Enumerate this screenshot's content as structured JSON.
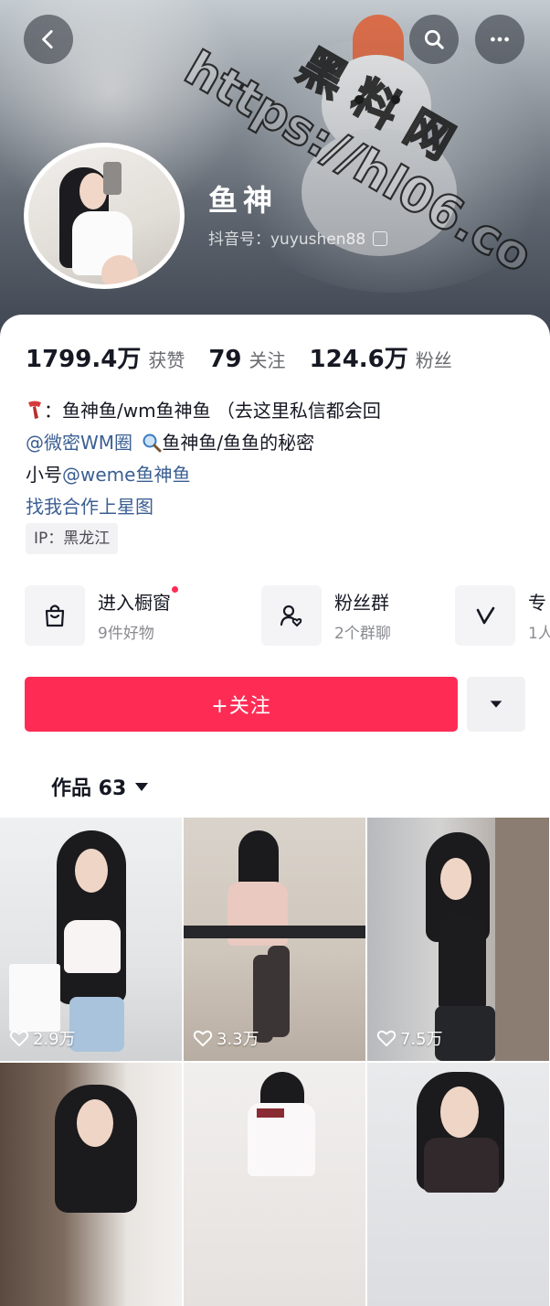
{
  "header": {
    "nickname": "鱼神",
    "douyin_id": "抖音号：yuyushen88",
    "watermark_line1": "黑 料 网",
    "watermark_line2": "https://hl06.co"
  },
  "stats": [
    {
      "value": "1799.4万",
      "label": "获赞"
    },
    {
      "value": "79",
      "label": "关注"
    },
    {
      "value": "124.6万",
      "label": "粉丝"
    }
  ],
  "bio": {
    "line1": "：鱼神鱼/wm鱼神鱼 （去这里私信都会回",
    "line2_link": "@微密WM圈",
    "line2_text": "鱼神鱼/鱼鱼的秘密",
    "line3_prefix": "小号",
    "line3_link": "@weme鱼神鱼",
    "line4_link": "找我合作上星图"
  },
  "ip_tag": "IP：黑龙江",
  "features": [
    {
      "title": "进入橱窗",
      "subtitle": "9件好物",
      "icon": "shopping-bag-icon"
    },
    {
      "title": "粉丝群",
      "subtitle": "2个群聊",
      "icon": "fan-group-icon"
    },
    {
      "title": "专",
      "subtitle": "1人",
      "icon": "v-logo-icon"
    }
  ],
  "actions": {
    "follow_label": "+关注"
  },
  "works_tab": {
    "label": "作品 63"
  },
  "videos": [
    {
      "likes": "2.9万"
    },
    {
      "likes": "3.3万"
    },
    {
      "likes": "7.5万"
    },
    {
      "likes": ""
    },
    {
      "likes": ""
    },
    {
      "likes": ""
    }
  ],
  "colors": {
    "accent": "#fe2c55",
    "link": "#3b5f93",
    "text_secondary": "#6a6b70"
  }
}
